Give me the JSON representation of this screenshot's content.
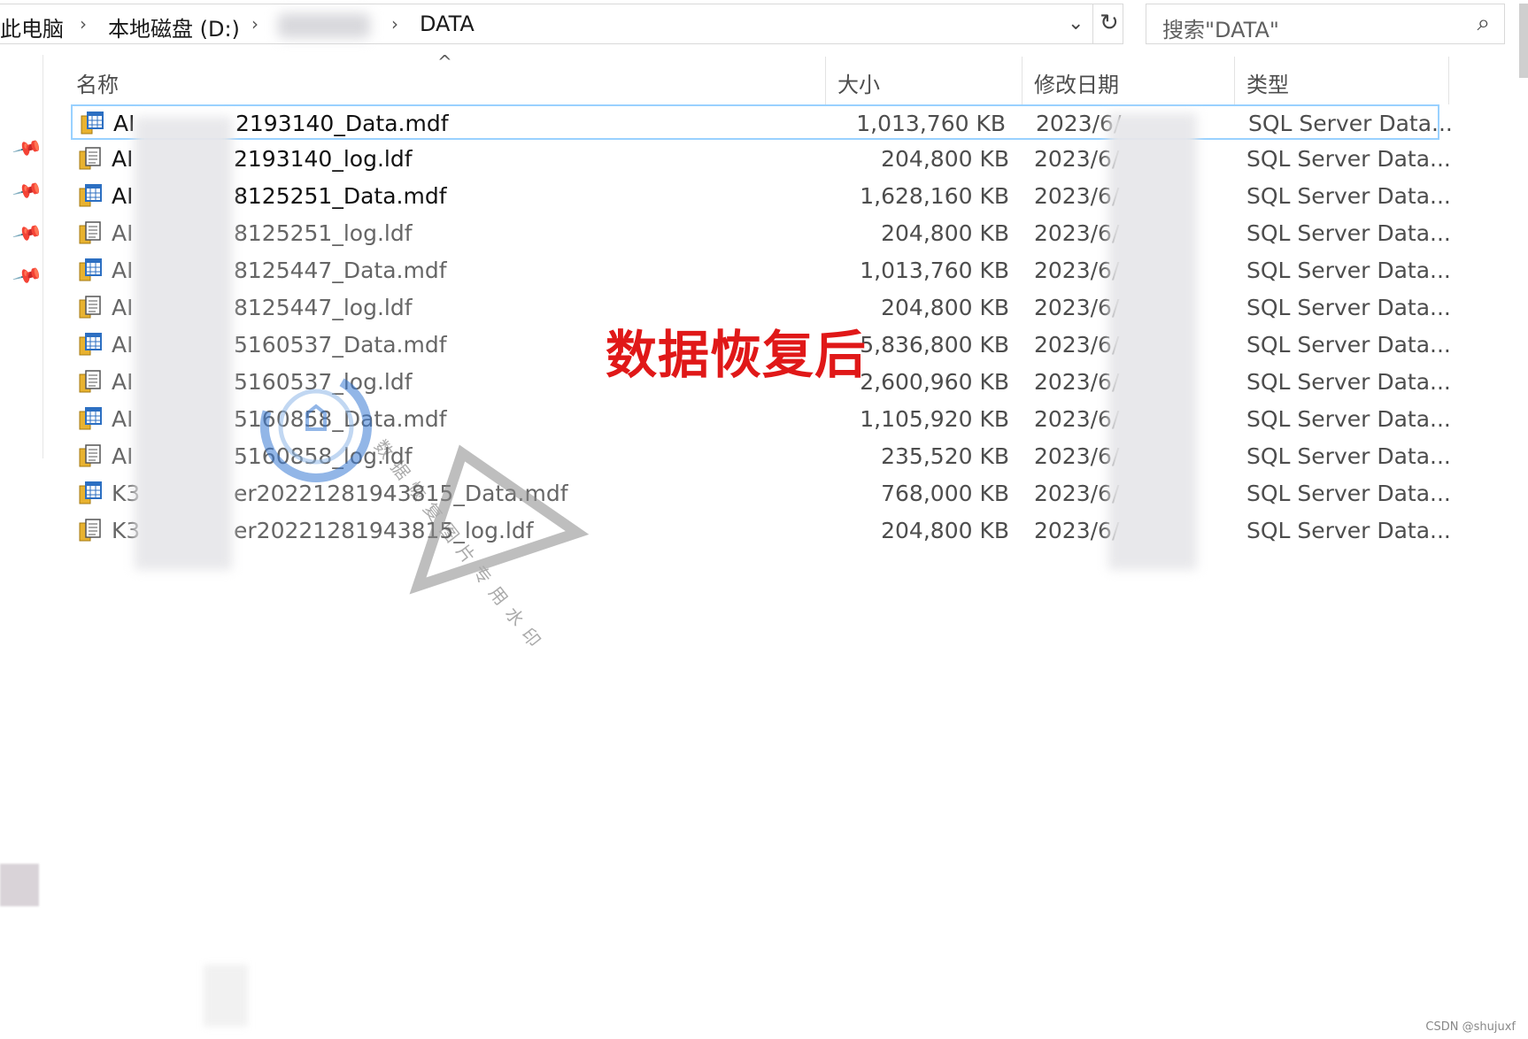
{
  "breadcrumb": {
    "items": [
      "此电脑",
      "本地磁盘 (D:)",
      "DATA"
    ]
  },
  "search": {
    "placeholder": "搜索\"DATA\""
  },
  "columns": {
    "name": "名称",
    "size": "大小",
    "modified": "修改日期",
    "type": "类型"
  },
  "files": [
    {
      "name_prefix": "AI",
      "name_suffix": "2193140_Data.mdf",
      "size": "1,013,760 KB",
      "date": "2023/6/",
      "type": "SQL Server Data...",
      "kind": "mdf"
    },
    {
      "name_prefix": "AI",
      "name_suffix": "2193140_log.ldf",
      "size": "204,800 KB",
      "date": "2023/6/",
      "type": "SQL Server Data...",
      "kind": "ldf"
    },
    {
      "name_prefix": "AI",
      "name_suffix": "8125251_Data.mdf",
      "size": "1,628,160 KB",
      "date": "2023/6/",
      "type": "SQL Server Data...",
      "kind": "mdf"
    },
    {
      "name_prefix": "AI",
      "name_suffix": "8125251_log.ldf",
      "size": "204,800 KB",
      "date": "2023/6/",
      "type": "SQL Server Data...",
      "kind": "ldf"
    },
    {
      "name_prefix": "AI",
      "name_suffix": "8125447_Data.mdf",
      "size": "1,013,760 KB",
      "date": "2023/6/",
      "type": "SQL Server Data...",
      "kind": "mdf"
    },
    {
      "name_prefix": "AI",
      "name_suffix": "8125447_log.ldf",
      "size": "204,800 KB",
      "date": "2023/6/",
      "type": "SQL Server Data...",
      "kind": "ldf"
    },
    {
      "name_prefix": "AI",
      "name_suffix": "5160537_Data.mdf",
      "size": "5,836,800 KB",
      "date": "2023/6/",
      "type": "SQL Server Data...",
      "kind": "mdf"
    },
    {
      "name_prefix": "AI",
      "name_suffix": "5160537_log.ldf",
      "size": "2,600,960 KB",
      "date": "2023/6/",
      "type": "SQL Server Data...",
      "kind": "ldf"
    },
    {
      "name_prefix": "AI",
      "name_suffix": "5160858_Data.mdf",
      "size": "1,105,920 KB",
      "date": "2023/6/",
      "type": "SQL Server Data...",
      "kind": "mdf"
    },
    {
      "name_prefix": "AI",
      "name_suffix": "5160858_log.ldf",
      "size": "235,520 KB",
      "date": "2023/6/",
      "type": "SQL Server Data...",
      "kind": "ldf"
    },
    {
      "name_prefix": "K3",
      "name_suffix": "er20221281943815_Data.mdf",
      "size": "768,000 KB",
      "date": "2023/6/",
      "type": "SQL Server Data...",
      "kind": "mdf"
    },
    {
      "name_prefix": "K3",
      "name_suffix": "er20221281943815_log.ldf",
      "size": "204,800 KB",
      "date": "2023/6/",
      "type": "SQL Server Data...",
      "kind": "ldf"
    }
  ],
  "annotation": "数据恢复后",
  "watermark_text": "数据恢复图片专用水印",
  "credit": "CSDN @shujuxf",
  "colors": {
    "annotation": "#e01818",
    "selection_border": "#99d1ff",
    "icon_blue": "#2c6fc2",
    "icon_yellow": "#e8b230"
  }
}
